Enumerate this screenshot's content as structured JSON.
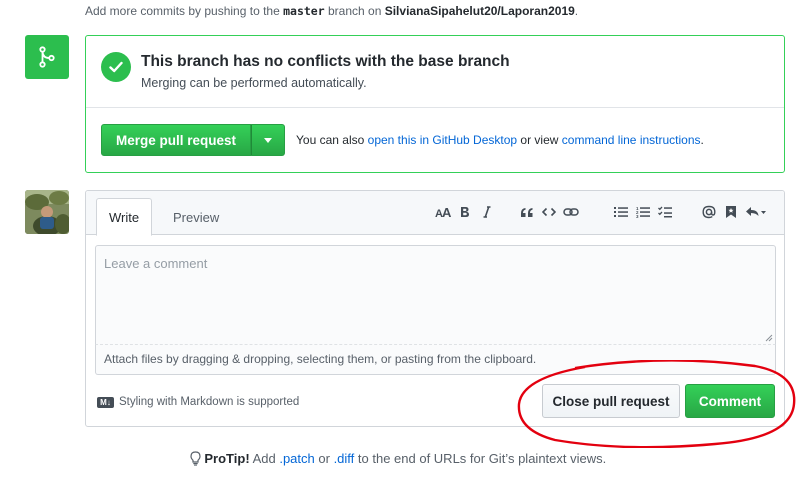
{
  "top_note": {
    "prefix": "Add more commits by pushing to the",
    "branch": "master",
    "middle": "branch on",
    "repo": "SilvianaSipahelut20/Laporan2019",
    "suffix": "."
  },
  "merge": {
    "title": "This branch has no conflicts with the base branch",
    "subtitle": "Merging can be performed automatically.",
    "merge_button": "Merge pull request",
    "also_prefix": "You can also",
    "desktop_link": "open this in GitHub Desktop",
    "or_view": "or view",
    "cli_link": "command line instructions",
    "also_suffix": "."
  },
  "comment": {
    "tabs": [
      {
        "label": "Write",
        "active": true
      },
      {
        "label": "Preview",
        "active": false
      }
    ],
    "toolbar_icons": [
      "heading-icon",
      "bold-icon",
      "italic-icon",
      "quote-icon",
      "code-icon",
      "link-icon",
      "unordered-list-icon",
      "ordered-list-icon",
      "task-list-icon",
      "mention-icon",
      "saved-reply-icon",
      "reply-icon"
    ],
    "placeholder": "Leave a comment",
    "attach_text": "Attach files by dragging & dropping, selecting them, or pasting from the clipboard.",
    "markdown_badge": "M↓",
    "markdown_note": "Styling with Markdown is supported",
    "close_button": "Close pull request",
    "comment_button": "Comment"
  },
  "protip": {
    "label": "ProTip!",
    "prefix": "Add",
    "patch": ".patch",
    "or": "or",
    "diff": ".diff",
    "suffix": "to the end of URLs for Git’s plaintext views."
  },
  "colors": {
    "green": "#2cbe4e",
    "link": "#0366d6",
    "annotation_red": "#e3000f"
  }
}
